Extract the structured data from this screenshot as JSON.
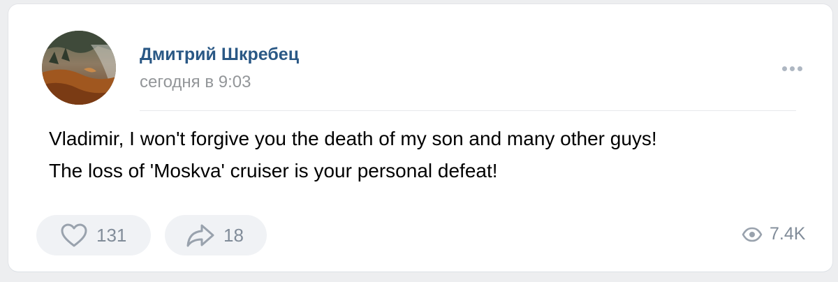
{
  "post": {
    "author": {
      "name": "Дмитрий Шкребец",
      "avatar_icon": "avatar-photo"
    },
    "time": "сегодня в 9:03",
    "more_icon": "more-dots-icon",
    "text_lines": [
      "Vladimir, I won't forgive you the death of my son and many other guys!",
      "The loss of 'Moskva' cruiser is your personal defeat!"
    ]
  },
  "actions": {
    "like": {
      "icon": "heart-icon",
      "count": "131"
    },
    "share": {
      "icon": "share-arrow-icon",
      "count": "18"
    },
    "views": {
      "icon": "eye-icon",
      "count": "7.4K"
    }
  },
  "colors": {
    "author_link": "#2a5885",
    "secondary_text": "#939699",
    "action_icon": "#99a2ad",
    "action_background": "#f0f2f5",
    "page_background": "#edeef0"
  }
}
